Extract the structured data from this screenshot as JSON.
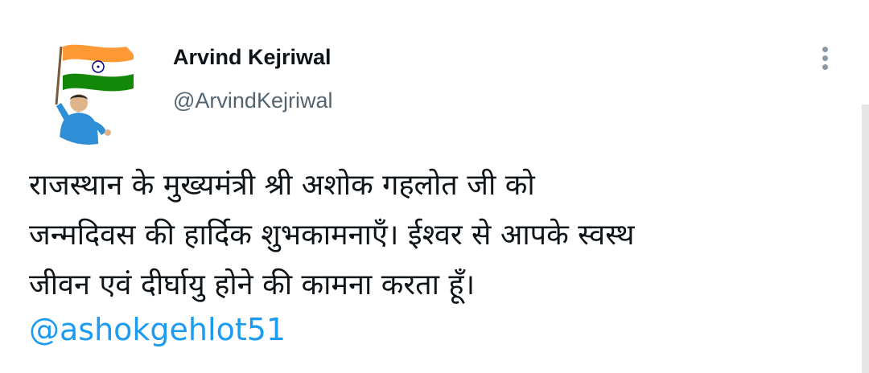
{
  "tweet": {
    "author": {
      "display_name": "Arvind Kejriwal",
      "handle": "@ArvindKejriwal",
      "avatar_icon": "profile-avatar-flag"
    },
    "more_icon": "more-options-icon",
    "text_lines": [
      "राजस्थान के मुख्यमंत्री श्री अशोक गहलोत जी को",
      "जन्मदिवस की हार्दिक शुभकामनाएँ। ईश्वर से आपके स्वस्थ",
      "जीवन एवं दीर्घायु होने की कामना करता हूँ।"
    ],
    "mention": "@ashokgehlot51"
  },
  "colors": {
    "text": "#0f1419",
    "secondary": "#536471",
    "link": "#1d9bf0",
    "flag_saffron": "#ff9933",
    "flag_green": "#138808",
    "chakra": "#000080"
  }
}
